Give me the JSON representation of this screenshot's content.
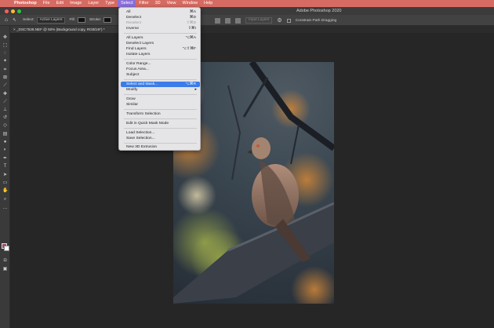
{
  "menubar": {
    "apple_icon": "apple-icon",
    "items": [
      "Photoshop",
      "File",
      "Edit",
      "Image",
      "Layer",
      "Type",
      "Select",
      "Filter",
      "3D",
      "View",
      "Window",
      "Help"
    ],
    "active_index": 6
  },
  "window": {
    "title": "Adobe Photoshop 2020"
  },
  "options": {
    "select_label": "Select:",
    "select_value": "Active Layers",
    "fill_label": "Fill:",
    "stroke_label": "Stroke:",
    "input_layers": "Input Layers",
    "constrain": "Constrain Path Dragging"
  },
  "document": {
    "tab_title": "_DSC7528.NEF @ 50% (Background copy, RGB/16*) *"
  },
  "menu": {
    "rows": [
      {
        "label": "All",
        "shortcut": "⌘A"
      },
      {
        "label": "Deselect",
        "shortcut": "⌘D"
      },
      {
        "label": "Reselect",
        "shortcut": "⇧⌘D"
      },
      {
        "label": "Inverse",
        "shortcut": "⇧⌘I"
      },
      {
        "label": "All Layers",
        "shortcut": "⌥⌘A"
      },
      {
        "label": "Deselect Layers",
        "shortcut": ""
      },
      {
        "label": "Find Layers",
        "shortcut": "⌥⇧⌘F"
      },
      {
        "label": "Isolate Layers",
        "shortcut": ""
      },
      {
        "label": "Color Range...",
        "shortcut": ""
      },
      {
        "label": "Focus Area...",
        "shortcut": ""
      },
      {
        "label": "Subject",
        "shortcut": ""
      },
      {
        "label": "Select and Mask...",
        "shortcut": "⌥⌘R"
      },
      {
        "label": "Modify",
        "shortcut": ""
      },
      {
        "label": "Grow",
        "shortcut": ""
      },
      {
        "label": "Similar",
        "shortcut": ""
      },
      {
        "label": "Transform Selection",
        "shortcut": ""
      },
      {
        "label": "Edit in Quick Mask Mode",
        "shortcut": ""
      },
      {
        "label": "Load Selection...",
        "shortcut": ""
      },
      {
        "label": "Save Selection...",
        "shortcut": ""
      },
      {
        "label": "New 3D Extrusion",
        "shortcut": ""
      }
    ],
    "highlighted_index": 11,
    "disabled_index": 2,
    "submenu_arrow": "▸"
  },
  "colors": {
    "menubar": "#d56b62",
    "highlight": "#3b7ce9",
    "foreground_color": "#a04a6a",
    "background_color": "#ffffff"
  },
  "icons": [
    "move-icon",
    "marquee-icon",
    "lasso-icon",
    "magic-wand-icon",
    "crop-icon",
    "frame-icon",
    "eyedropper-icon",
    "healing-icon",
    "brush-icon",
    "clone-stamp-icon",
    "history-brush-icon",
    "eraser-icon",
    "gradient-icon",
    "blur-icon",
    "dodge-icon",
    "pen-icon",
    "type-icon",
    "path-select-icon",
    "shape-icon",
    "hand-icon",
    "zoom-icon",
    "more-tools-icon"
  ]
}
